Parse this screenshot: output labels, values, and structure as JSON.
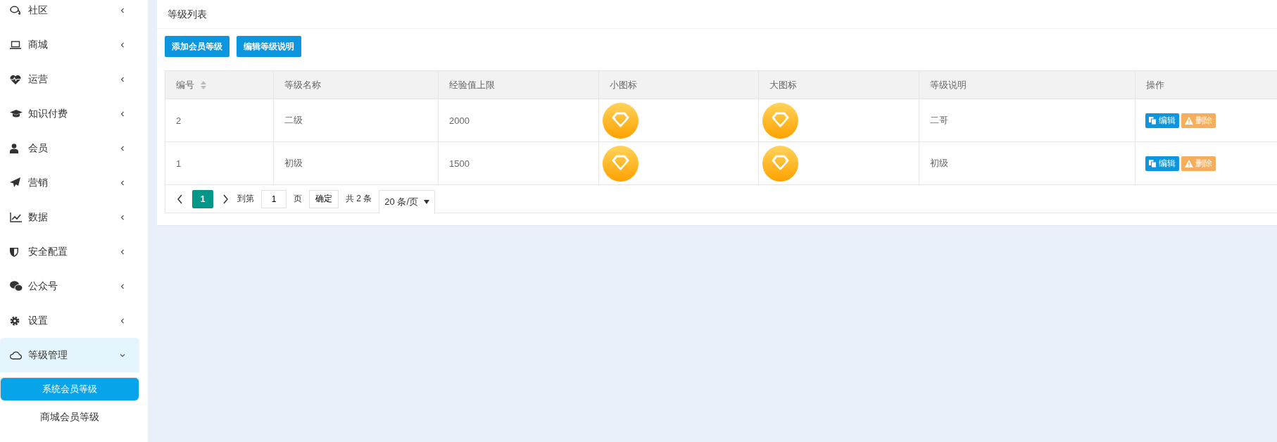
{
  "sidebar": {
    "items": [
      {
        "label": "社区",
        "kind": "chat",
        "expanded": false
      },
      {
        "label": "商城",
        "kind": "laptop",
        "expanded": false
      },
      {
        "label": "运营",
        "kind": "heartbeat",
        "expanded": false
      },
      {
        "label": "知识付费",
        "kind": "graduation",
        "expanded": false
      },
      {
        "label": "会员",
        "kind": "user",
        "expanded": false
      },
      {
        "label": "营销",
        "kind": "plane",
        "expanded": false
      },
      {
        "label": "数据",
        "kind": "chart",
        "expanded": false
      },
      {
        "label": "安全配置",
        "kind": "shield",
        "expanded": false
      },
      {
        "label": "公众号",
        "kind": "wechat",
        "expanded": false
      },
      {
        "label": "设置",
        "kind": "gear",
        "expanded": false
      },
      {
        "label": "等级管理",
        "kind": "cloud",
        "expanded": true,
        "children": [
          {
            "label": "系统会员等级",
            "selected": true
          },
          {
            "label": "商城会员等级",
            "selected": false
          }
        ]
      }
    ]
  },
  "card": {
    "title": "等级列表",
    "buttons": [
      "添加会员等级",
      "编辑等级说明"
    ],
    "table": {
      "columns": [
        {
          "label": "编号",
          "sortable": true
        },
        {
          "label": "等级名称",
          "sortable": false
        },
        {
          "label": "经验值上限",
          "sortable": false
        },
        {
          "label": "小图标",
          "sortable": false
        },
        {
          "label": "大图标",
          "sortable": false
        },
        {
          "label": "等级说明",
          "sortable": false
        },
        {
          "label": "操作",
          "sortable": false
        }
      ],
      "rows": [
        {
          "id": "2",
          "name": "二级",
          "exp": "2000",
          "desc": "二哥",
          "actions": [
            "编辑",
            "删除"
          ]
        },
        {
          "id": "1",
          "name": "初级",
          "exp": "1500",
          "desc": "初级",
          "actions": [
            "编辑",
            "删除"
          ]
        }
      ]
    },
    "pagination": {
      "pages": [
        {
          "label": "1",
          "selected": true
        }
      ],
      "goto_label": "到第",
      "goto_value": "1",
      "page_unit": "页",
      "confirm": "确定",
      "total": "共 2 条",
      "page_size": "20 条/页"
    }
  }
}
